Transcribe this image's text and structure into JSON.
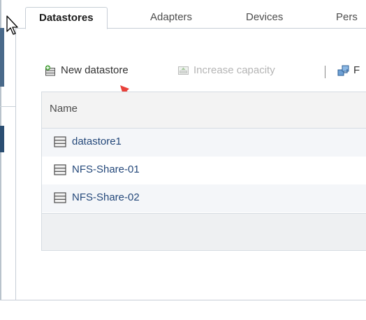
{
  "tabs": [
    {
      "label": "Datastores",
      "active": true
    },
    {
      "label": "Adapters",
      "active": false
    },
    {
      "label": "Devices",
      "active": false
    },
    {
      "label": "Pers",
      "active": false
    }
  ],
  "toolbar": {
    "new_datastore": {
      "label": "New datastore",
      "icon": "new-datastore-icon",
      "enabled": true
    },
    "increase_capacity": {
      "label": "Increase capacity",
      "icon": "increase-capacity-icon",
      "enabled": false
    },
    "truncated": {
      "label": "F",
      "icon": "register-vm-icon",
      "enabled": true
    }
  },
  "table": {
    "columns": [
      "Name"
    ],
    "rows": [
      {
        "name": "datastore1",
        "icon": "datastore-icon"
      },
      {
        "name": "NFS-Share-01",
        "icon": "datastore-icon"
      },
      {
        "name": "NFS-Share-02",
        "icon": "datastore-icon"
      }
    ]
  },
  "colors": {
    "link": "#24487a",
    "annotation_arrow": "#e8413a",
    "disabled_text": "#b5b5b5",
    "header_bg": "#f3f3f3"
  }
}
